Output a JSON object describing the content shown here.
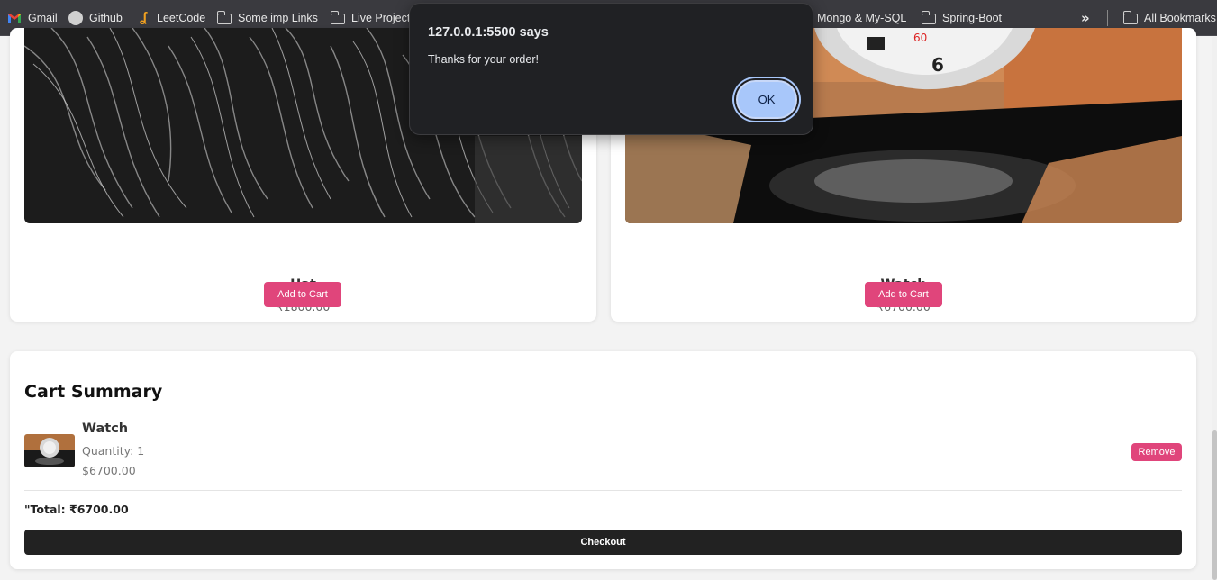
{
  "bookmarks": {
    "items": [
      {
        "label": "Gmail",
        "icon": "gmail-icon"
      },
      {
        "label": "Github",
        "icon": "github-icon"
      },
      {
        "label": "LeetCode",
        "icon": "leetcode-icon"
      },
      {
        "label": "Some imp Links",
        "icon": "folder-icon"
      },
      {
        "label": "Live Project",
        "icon": "folder-icon"
      },
      {
        "label": "Mongo & My-SQL",
        "icon": "folder-icon"
      },
      {
        "label": "Spring-Boot",
        "icon": "folder-icon"
      }
    ],
    "overflow": "»",
    "all_bookmarks": "All Bookmarks"
  },
  "products": [
    {
      "name": "Hat",
      "price": "₹1800.00",
      "button": "Add to Cart"
    },
    {
      "name": "Watch",
      "price": "₹6700.00",
      "button": "Add to Cart"
    }
  ],
  "cart": {
    "title": "Cart Summary",
    "item": {
      "name": "Watch",
      "quantity": "Quantity: 1",
      "price": "$6700.00",
      "remove": "Remove"
    },
    "total": "\"Total: ₹6700.00",
    "checkout": "Checkout"
  },
  "dialog": {
    "origin": "127.0.0.1:5500 says",
    "message": "Thanks for your order!",
    "ok": "OK",
    "ok_color": "#a8c7fa"
  },
  "colors": {
    "accent": "#e0457b",
    "checkout_bg": "#222222",
    "bookmarks_bg": "#3a3a3f"
  }
}
